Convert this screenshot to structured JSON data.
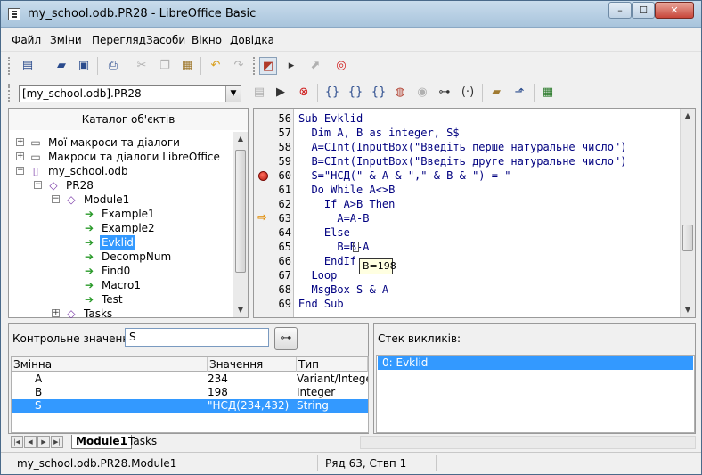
{
  "window": {
    "title": "my_school.odb.PR28 - LibreOffice Basic",
    "min_label": "–",
    "max_label": "☐",
    "close_label": "✕"
  },
  "menu": [
    "Файл",
    "Зміни",
    "Перегляд",
    "Засоби",
    "Вікно",
    "Довідка"
  ],
  "library_select": {
    "value": "[my_school.odb].PR28"
  },
  "catalog": {
    "title": "Каталог об'єктів",
    "tree": [
      {
        "label": "Мої макроси та діалоги",
        "icon": "drive-icon",
        "expander": "+"
      },
      {
        "label": "Макроси та діалоги LibreOffice",
        "icon": "drive-icon",
        "expander": "+"
      },
      {
        "label": "my_school.odb",
        "icon": "database-icon",
        "expander": "−"
      },
      {
        "label": "PR28",
        "icon": "library-icon",
        "expander": "−"
      },
      {
        "label": "Module1",
        "icon": "module-icon",
        "expander": "−"
      },
      {
        "label": "Example1",
        "icon": "macro-icon",
        "expander": ""
      },
      {
        "label": "Example2",
        "icon": "macro-icon",
        "expander": ""
      },
      {
        "label": "Evklid",
        "icon": "macro-icon",
        "expander": "",
        "selected": true
      },
      {
        "label": "DecompNum",
        "icon": "macro-icon",
        "expander": ""
      },
      {
        "label": "Find0",
        "icon": "macro-icon",
        "expander": ""
      },
      {
        "label": "Macro1",
        "icon": "macro-icon",
        "expander": ""
      },
      {
        "label": "Test",
        "icon": "macro-icon",
        "expander": ""
      },
      {
        "label": "Tasks",
        "icon": "module-icon",
        "expander": "+"
      }
    ]
  },
  "editor": {
    "line_numbers": [
      "56",
      "57",
      "58",
      "59",
      "60",
      "61",
      "62",
      "63",
      "64",
      "65",
      "66",
      "67",
      "68",
      "69"
    ],
    "lines": [
      "Sub Evklid",
      "  Dim A, B as integer, S$",
      "  A=CInt(InputBox(\"Введіть перше натуральне число\")",
      "  B=CInt(InputBox(\"Введіть друге натуральне число\")",
      "  S=\"НСД(\" & A & \",\" & B & \") = \"",
      "  Do While A<>B",
      "    If A>B Then",
      "      A=A-B",
      "    Else",
      "      B=B-A",
      "    EndIf",
      "  Loop",
      "  MsgBox S & A",
      "End Sub"
    ],
    "breakpoint_line": "60",
    "current_line": "63",
    "tooltip": "B=198"
  },
  "watch": {
    "label": "Контрольне значення:",
    "input_value": "S",
    "columns": [
      "Змінна",
      "Значення",
      "Тип"
    ],
    "rows": [
      {
        "name": "A",
        "value": "234",
        "type": "Variant/Integer"
      },
      {
        "name": "B",
        "value": "198",
        "type": "Integer"
      },
      {
        "name": "S",
        "value": "\"НСД(234,432) =",
        "type": "String"
      }
    ]
  },
  "call_stack": {
    "label": "Стек викликів:",
    "items": [
      "0: Evklid"
    ]
  },
  "tabs": [
    "Module1",
    "Tasks"
  ],
  "status": {
    "location": "my_school.odb.PR28.Module1",
    "position": "Ряд 63, Ствп 1"
  },
  "colors": {
    "selection": "#3399ff",
    "keyword": "#000080",
    "string": "#ce181e",
    "comment": "#006400",
    "breakpoint": "#b41a10",
    "current_line_arrow": "#e08a00"
  }
}
